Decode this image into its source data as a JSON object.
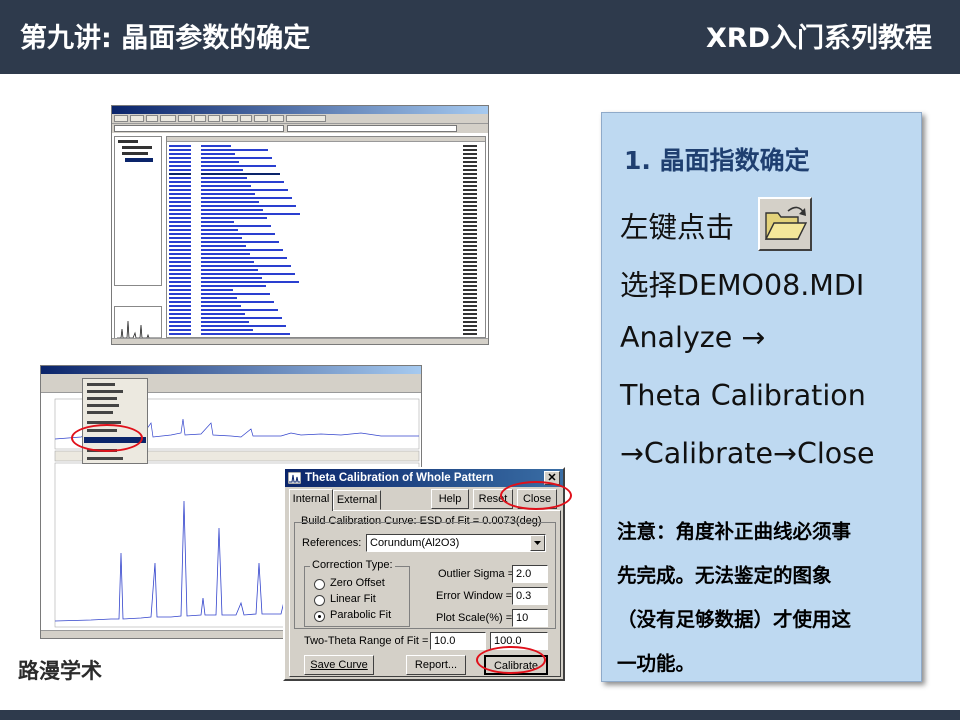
{
  "header": {
    "title": "第九讲: 晶面参数的确定",
    "series": "XRD入门系列教程"
  },
  "footer": {
    "brand": "路漫学术"
  },
  "dialog": {
    "title": "Theta Calibration of Whole Pattern",
    "close_glyph": "✕",
    "tabs": [
      {
        "label": "Internal",
        "active": true
      },
      {
        "label": "External",
        "active": false
      }
    ],
    "buttons": {
      "help": "Help",
      "reset": "Reset",
      "close": "Close",
      "save_curve": "Save Curve",
      "report": "Report...",
      "calibrate": "Calibrate"
    },
    "build_caption": "Build Calibration Curve: ESD of Fit = 0.0073(deg)",
    "references_label": "References:",
    "references_value": "Corundum(Al2O3)",
    "correction": {
      "caption": "Correction Type:",
      "options": [
        {
          "label": "Zero Offset",
          "checked": false
        },
        {
          "label": "Linear Fit",
          "checked": false
        },
        {
          "label": "Parabolic Fit",
          "checked": true
        }
      ]
    },
    "outlier_label": "Outlier Sigma =",
    "outlier_value": "2.0",
    "error_window_label": "Error Window =",
    "error_window_value": "0.3",
    "plot_scale_label": "Plot Scale(%) =",
    "plot_scale_value": "10",
    "range_label": "Two-Theta Range of Fit =",
    "range_from": "10.0",
    "range_to": "100.0"
  },
  "panel": {
    "heading": "1. 晶面指数确定",
    "step_click": "左键点击",
    "open_icon": "open-folder-icon",
    "step_select": "选择DEMO08.MDI",
    "step_analyze": "Analyze →",
    "step_theta": "Theta Calibration",
    "step_final": "→Calibrate→Close",
    "note_lines": [
      "注意：角度补正曲线必须事",
      "先完成。无法鉴定的图象",
      "（没有足够数据）才使用这",
      "一功能。"
    ]
  },
  "colors": {
    "header_bg": "#2e3a4c",
    "panel_bg": "#bed9f1",
    "heading_color": "#1f3f70",
    "highlight_red": "#e0101a",
    "spectrum_blue": "#3344cc",
    "win_face": "#d4d0c8",
    "title_bar": "#0a246a"
  }
}
